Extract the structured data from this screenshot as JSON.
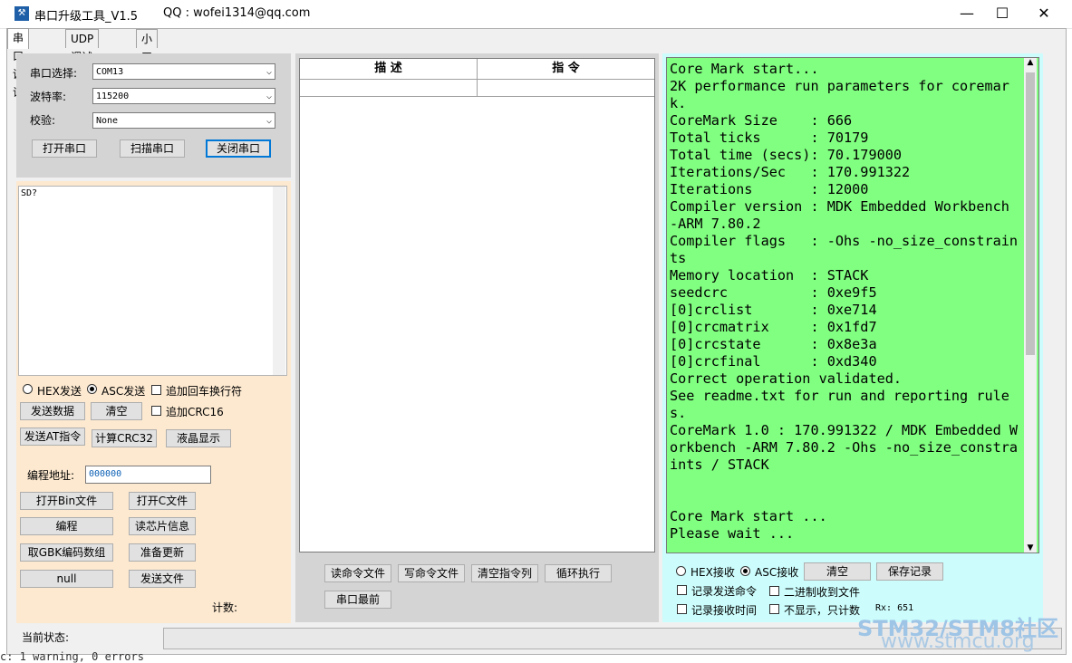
{
  "window": {
    "title": "串口升级工具_V1.5",
    "qq": "QQ : wofei1314@qq.com",
    "minimize": "—",
    "maximize": "☐",
    "close": "✕"
  },
  "tabs": [
    "串口调试",
    "UDP调试工具",
    "小工具"
  ],
  "serial": {
    "port_label": "串口选择:",
    "port_value": "COM13",
    "baud_label": "波特率:",
    "baud_value": "115200",
    "parity_label": "校验:",
    "parity_value": "None",
    "open_button": "打开串口",
    "scan_button": "扫描串口",
    "close_button": "关闭串口"
  },
  "send": {
    "text": "SD?",
    "hex_send": "HEX发送",
    "asc_send": "ASC发送",
    "append_crlf": "追加回车换行符",
    "send_data_button": "发送数据",
    "clear_button": "清空",
    "append_crc": "追加CRC16",
    "send_at_button": "发送AT指令",
    "crc32_button": "计算CRC32",
    "lcd_button": "液晶显示",
    "addr_label": "编程地址:",
    "addr_value": "000000",
    "open_bin_button": "打开Bin文件",
    "open_c_button": "打开C文件",
    "program_button": "编程",
    "read_chip_button": "读芯片信息",
    "gbk_button": "取GBK编码数组",
    "prepare_update_button": "准备更新",
    "null_button": "null",
    "send_file_button": "发送文件",
    "count_label": "计数:"
  },
  "commands": {
    "col_desc": "描 述",
    "col_cmd": "指 令",
    "read_file_button": "读命令文件",
    "write_file_button": "写命令文件",
    "clear_list_button": "清空指令列",
    "loop_button": "循环执行",
    "front_button": "串口最前"
  },
  "receive": {
    "console_text": "Core Mark start...\n2K performance run parameters for coremark.\nCoreMark Size    : 666\nTotal ticks      : 70179\nTotal time (secs): 70.179000\nIterations/Sec   : 170.991322\nIterations       : 12000\nCompiler version : MDK Embedded Workbench -ARM 7.80.2\nCompiler flags   : -Ohs -no_size_constraints\nMemory location  : STACK\nseedcrc          : 0xe9f5\n[0]crclist       : 0xe714\n[0]crcmatrix     : 0x1fd7\n[0]crcstate      : 0x8e3a\n[0]crcfinal      : 0xd340\nCorrect operation validated.\nSee readme.txt for run and reporting rules.\nCoreMark 1.0 : 170.991322 / MDK Embedded Workbench -ARM 7.80.2 -Ohs -no_size_constraints / STACK\n\n\nCore Mark start ...\nPlease wait ...",
    "hex_recv": "HEX接收",
    "asc_recv": "ASC接收",
    "clear_button": "清空",
    "save_button": "保存记录",
    "log_send": "记录发送命令",
    "binary_to_file": "二进制收到文件",
    "log_time": "记录接收时间",
    "no_display": "不显示，只计数",
    "rx_count": "Rx: 651"
  },
  "status": {
    "label": "当前状态:"
  },
  "watermark": {
    "line1": "STM32/STM8社区",
    "line2": "www.stmcu.org"
  },
  "background_text": "c: 1 warning, 0 errors"
}
